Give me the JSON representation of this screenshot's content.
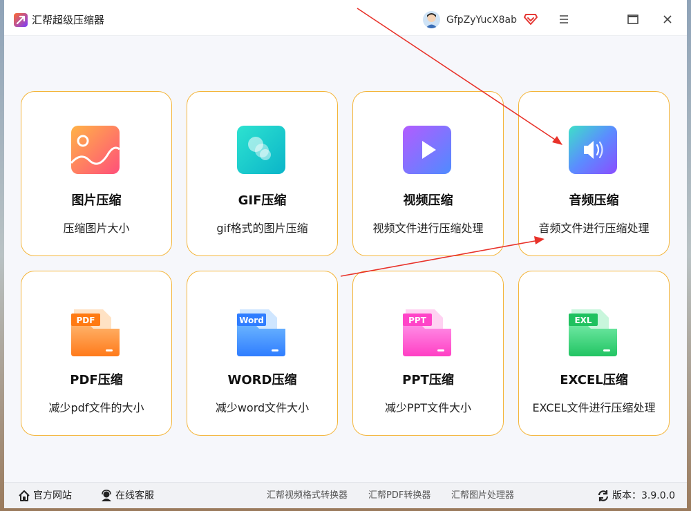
{
  "app": {
    "title": "汇帮超级压缩器",
    "username": "GfpZyYucX8ab"
  },
  "cards": [
    {
      "title": "图片压缩",
      "desc": "压缩图片大小",
      "icon": "image-icon"
    },
    {
      "title": "GIF压缩",
      "desc": "gif格式的图片压缩",
      "icon": "gif-icon"
    },
    {
      "title": "视频压缩",
      "desc": "视频文件进行压缩处理",
      "icon": "video-play-icon"
    },
    {
      "title": "音频压缩",
      "desc": "音频文件进行压缩处理",
      "icon": "speaker-icon"
    },
    {
      "title": "PDF压缩",
      "desc": "减少pdf文件的大小",
      "icon": "pdf-folder-icon",
      "badge": "PDF"
    },
    {
      "title": "WORD压缩",
      "desc": "减少word文件大小",
      "icon": "word-folder-icon",
      "badge": "Word"
    },
    {
      "title": "PPT压缩",
      "desc": "减少PPT文件大小",
      "icon": "ppt-folder-icon",
      "badge": "PPT"
    },
    {
      "title": "EXCEL压缩",
      "desc": "EXCEL文件进行压缩处理",
      "icon": "excel-folder-icon",
      "badge": "EXL"
    }
  ],
  "footer": {
    "website": "官方网站",
    "support": "在线客服",
    "link1": "汇帮视频格式转换器",
    "link2": "汇帮PDF转换器",
    "link3": "汇帮图片处理器",
    "version": "版本：3.9.0.0"
  },
  "colors": {
    "card_border": "#f4b53a",
    "annotation_arrow": "#e8322a"
  }
}
